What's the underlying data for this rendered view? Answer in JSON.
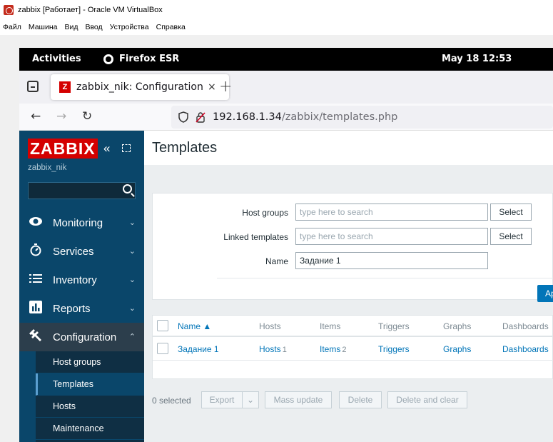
{
  "vbox": {
    "title": "zabbix [Работает] - Oracle VM VirtualBox",
    "menu": [
      "Файл",
      "Машина",
      "Вид",
      "Ввод",
      "Устройства",
      "Справка"
    ]
  },
  "gnome": {
    "activities": "Activities",
    "app_name": "Firefox ESR",
    "clock": "May 18  12:53"
  },
  "browser": {
    "tab_title": "zabbix_nik: Configuration of templates",
    "tab_close": "×",
    "new_tab": "+",
    "url_host": "192.168.1.34",
    "url_path": "/zabbix/templates.php"
  },
  "sidebar": {
    "logo": "ZABBIX",
    "server_name": "zabbix_nik",
    "search_value": "",
    "items": [
      {
        "label": "Monitoring",
        "icon": "eye-icon"
      },
      {
        "label": "Services",
        "icon": "stopwatch-icon"
      },
      {
        "label": "Inventory",
        "icon": "list-icon"
      },
      {
        "label": "Reports",
        "icon": "bar-chart-icon"
      },
      {
        "label": "Configuration",
        "icon": "wrench-icon"
      }
    ],
    "submenu": [
      "Host groups",
      "Templates",
      "Hosts",
      "Maintenance"
    ]
  },
  "main": {
    "title": "Templates",
    "filter": {
      "host_groups_label": "Host groups",
      "host_groups_placeholder": "type here to search",
      "linked_templates_label": "Linked templates",
      "linked_templates_placeholder": "type here to search",
      "name_label": "Name",
      "name_value": "Задание 1",
      "select_label": "Select",
      "apply_label": "Ap"
    },
    "table": {
      "headers": [
        "Name ▲",
        "Hosts",
        "Items",
        "Triggers",
        "Graphs",
        "Dashboards"
      ],
      "rows": [
        {
          "name": "Задание 1",
          "hosts": "Hosts",
          "hosts_count": "1",
          "items": "Items",
          "items_count": "2",
          "triggers": "Triggers",
          "graphs": "Graphs",
          "dashboards": "Dashboards"
        }
      ]
    },
    "actions": {
      "selected": "0 selected",
      "export": "Export",
      "mass_update": "Mass update",
      "delete": "Delete",
      "delete_clear": "Delete and clear"
    }
  }
}
